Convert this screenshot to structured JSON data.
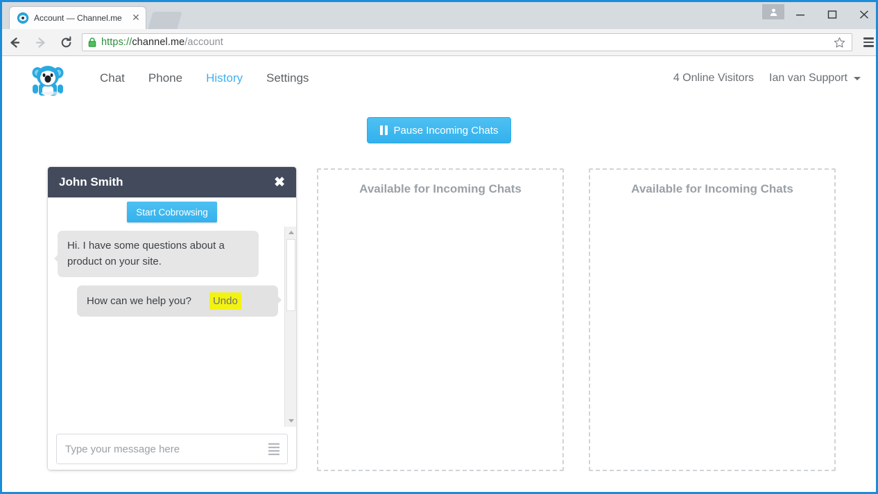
{
  "browser": {
    "tab": {
      "title": "Account — Channel.me",
      "close_label": "✕",
      "favicon": "channel-favicon"
    },
    "window_controls": {
      "profile": "profile-icon",
      "minimize": "minimize-icon",
      "maximize": "maximize-icon",
      "close": "close-icon"
    },
    "nav": {
      "back": "back-arrow-icon",
      "forward": "forward-arrow-icon",
      "reload": "reload-icon"
    },
    "address": {
      "lock": "lock-icon",
      "scheme": "https://",
      "host": "channel.me",
      "path": "/account",
      "full_url": "https://channel.me/account"
    },
    "bookmark_icon": "star-icon",
    "menu_icon": "hamburger-menu-icon"
  },
  "app": {
    "logo": "channel-koala-logo",
    "nav_links": [
      {
        "label": "Chat",
        "active": false
      },
      {
        "label": "Phone",
        "active": false
      },
      {
        "label": "History",
        "active": true
      },
      {
        "label": "Settings",
        "active": false
      }
    ],
    "visitors": "4 Online Visitors",
    "user": "Ian van Support",
    "pause_button": {
      "label": "Pause Incoming Chats",
      "icon": "pause-icon"
    }
  },
  "chat": {
    "title": "John Smith",
    "close_label": "✖",
    "cobrowse_label": "Start Cobrowsing",
    "messages": [
      {
        "side": "left",
        "text": "Hi. I have some questions about a product on your site."
      },
      {
        "side": "right",
        "text": "How can we help you?",
        "undo_label": "Undo"
      }
    ],
    "input": {
      "value": "",
      "placeholder": "Type your message here",
      "list_icon": "canned-responses-icon"
    },
    "scrollbar": {
      "up": "scroll-up-arrow-icon",
      "down": "scroll-down-arrow-icon"
    }
  },
  "empty_slots": [
    {
      "label": "Available for Incoming Chats"
    },
    {
      "label": "Available for Incoming Chats"
    }
  ],
  "colors": {
    "accent_blue": "#3fb8ef",
    "chat_header": "#434a5c",
    "undo_highlight": "#f3f312",
    "link_active": "#3fb0ef"
  }
}
